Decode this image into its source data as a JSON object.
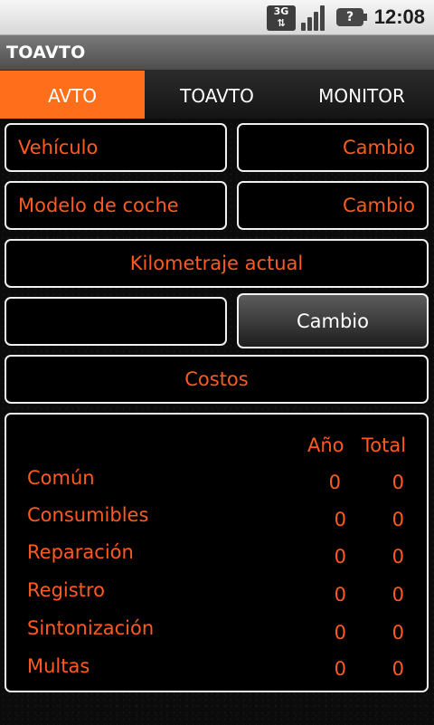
{
  "status_bar": {
    "network": "3G",
    "battery_icon": "battery-unknown-icon",
    "time": "12:08"
  },
  "app": {
    "title": "TOAVTO"
  },
  "tabs": [
    {
      "label": "AVTO",
      "active": true
    },
    {
      "label": "TOAVTO",
      "active": false
    },
    {
      "label": "MONITOR",
      "active": false
    }
  ],
  "vehicle": {
    "label": "Vehículo",
    "change": "Cambio"
  },
  "model": {
    "label": "Modelo de coche",
    "change": "Cambio"
  },
  "mileage": {
    "label": "Kilometraje actual",
    "value": "",
    "change": "Cambio"
  },
  "costs": {
    "label": "Costos",
    "col_year": "Año",
    "col_total": "Total",
    "rows": [
      {
        "name": "Común",
        "year": "0",
        "total": "0"
      },
      {
        "name": "Consumibles",
        "year": "0",
        "total": "0"
      },
      {
        "name": "Reparación",
        "year": "0",
        "total": "0"
      },
      {
        "name": "Registro",
        "year": "0",
        "total": "0"
      },
      {
        "name": "Sintonización",
        "year": "0",
        "total": "0"
      },
      {
        "name": "Multas",
        "year": "0",
        "total": "0"
      }
    ]
  },
  "colors": {
    "accent": "#ff6e1a",
    "text_accent": "#ff5a1f",
    "border": "#f0f0f0",
    "background": "#0b0b0b"
  }
}
